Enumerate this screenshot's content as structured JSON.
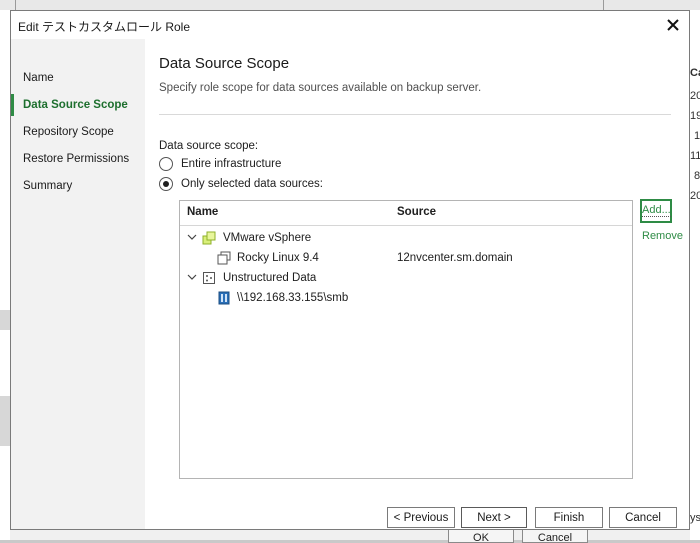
{
  "dialog": {
    "title": "Edit テストカスタムロール Role",
    "close_glyph": "✕"
  },
  "sidebar": {
    "items": [
      {
        "label": "Name"
      },
      {
        "label": "Data Source Scope"
      },
      {
        "label": "Repository Scope"
      },
      {
        "label": "Restore Permissions"
      },
      {
        "label": "Summary"
      }
    ]
  },
  "main": {
    "title": "Data Source Scope",
    "subtitle": "Specify role scope for data sources available on backup server.",
    "scope_label": "Data source scope:",
    "options": [
      {
        "label": "Entire infrastructure",
        "selected": false
      },
      {
        "label": "Only selected data sources:",
        "selected": true
      }
    ],
    "table": {
      "columns": [
        "Name",
        "Source"
      ],
      "rows": [
        {
          "name": "VMware vSphere",
          "source": "",
          "icon": "vsphere-icon"
        },
        {
          "name": "Rocky Linux 9.4",
          "source": "12nvcenter.sm.domain",
          "icon": "vm-icon"
        },
        {
          "name": "Unstructured Data",
          "source": "",
          "icon": "unstructured-data-icon"
        },
        {
          "name": "\\\\192.168.33.155\\smb",
          "source": "",
          "icon": "smb-share-icon"
        }
      ]
    },
    "add_label": "Add...",
    "remove_label": "Remove"
  },
  "footer": {
    "previous": "< Previous",
    "next": "Next >",
    "finish": "Finish",
    "cancel": "Cancel"
  },
  "background": {
    "right_cells": [
      "Ca",
      "20",
      "19",
      "1",
      "11",
      "8",
      "20",
      "ys"
    ],
    "ok": "OK",
    "cancel": "Cancel"
  },
  "colors": {
    "accent": "#2e8b45",
    "sidebar_bg": "#f2f2f2"
  }
}
